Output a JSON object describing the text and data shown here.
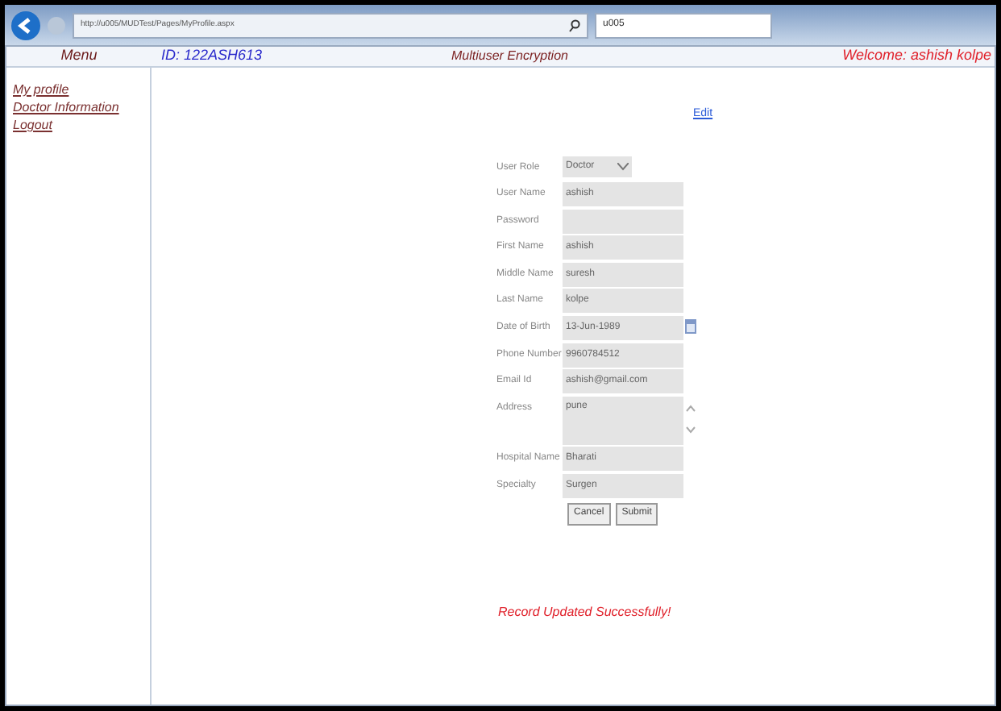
{
  "browser": {
    "address": "http://u005/MUDTest/Pages/MyProfile.aspx",
    "tab_title": "u005"
  },
  "header": {
    "menu_title": "Menu",
    "id_text": "ID: 122ASH613",
    "app_title": "Multiuser Encryption",
    "welcome": "Welcome: ashish kolpe"
  },
  "sidebar": {
    "items": [
      {
        "label": "My profile"
      },
      {
        "label": "Doctor Information"
      },
      {
        "label": "Logout"
      }
    ]
  },
  "edit_link": "Edit",
  "form": {
    "fields": [
      {
        "label": "User Role",
        "kind": "select",
        "value": "Doctor"
      },
      {
        "label": "User Name",
        "kind": "text",
        "value": "ashish"
      },
      {
        "label": "Password",
        "kind": "text"
      },
      {
        "label": "First Name",
        "kind": "text",
        "value": "ashish"
      },
      {
        "label": "Middle Name",
        "kind": "text",
        "value": "suresh"
      },
      {
        "label": "Last Name",
        "kind": "text",
        "value": "kolpe"
      },
      {
        "label": "Date of Birth",
        "kind": "date",
        "value": "13-Jun-1989"
      },
      {
        "label": "Phone Number",
        "kind": "text",
        "value": "9960784512"
      },
      {
        "label": "Email Id",
        "kind": "text",
        "value": "ashish@gmail.com"
      },
      {
        "label": "Address",
        "kind": "textarea",
        "value": "pune"
      },
      {
        "label": "Hospital Name",
        "kind": "text",
        "value": "Bharati"
      },
      {
        "label": "Specialty",
        "kind": "text",
        "value": "Surgen"
      }
    ],
    "buttons": [
      "Cancel",
      "Submit"
    ]
  },
  "message": "Record Updated Successfully!"
}
